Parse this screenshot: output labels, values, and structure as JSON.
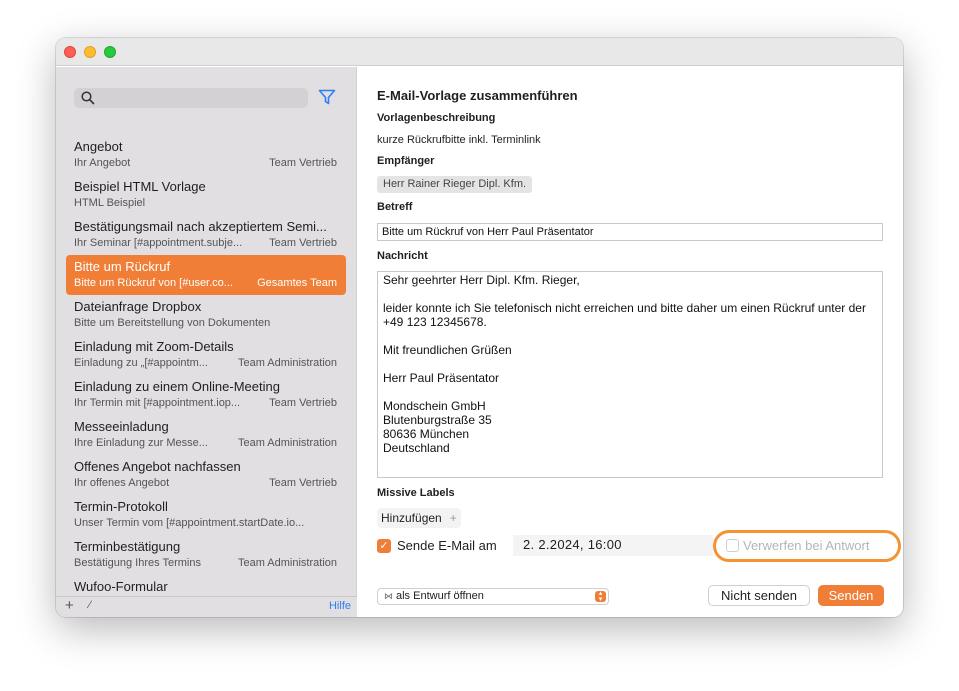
{
  "window": {
    "accent_color": "#f07e37"
  },
  "sidebar": {
    "search": {
      "value": "",
      "placeholder": ""
    },
    "items": [
      {
        "title": "Angebot",
        "subtitle": "Ihr Angebot",
        "group": "Team Vertrieb",
        "selected": false
      },
      {
        "title": "Beispiel HTML Vorlage",
        "subtitle": "HTML Beispiel",
        "group": "",
        "selected": false
      },
      {
        "title": "Bestätigungsmail nach akzeptiertem Semi...",
        "subtitle": "Ihr Seminar [#appointment.subje...",
        "group": "Team Vertrieb",
        "selected": false
      },
      {
        "title": "Bitte um Rückruf",
        "subtitle": "Bitte um Rückruf von [#user.co...",
        "group": "Gesamtes Team",
        "selected": true
      },
      {
        "title": "Dateianfrage Dropbox",
        "subtitle": "Bitte um Bereitstellung von Dokumenten",
        "group": "",
        "selected": false
      },
      {
        "title": "Einladung mit Zoom-Details",
        "subtitle": "Einladung zu „[#appointm...",
        "group": "Team Administration",
        "selected": false
      },
      {
        "title": "Einladung zu einem Online-Meeting",
        "subtitle": "Ihr Termin mit [#appointment.iop...",
        "group": "Team Vertrieb",
        "selected": false
      },
      {
        "title": "Messeeinladung",
        "subtitle": "Ihre Einladung zur Messe...",
        "group": "Team Administration",
        "selected": false
      },
      {
        "title": "Offenes Angebot nachfassen",
        "subtitle": "Ihr offenes Angebot",
        "group": "Team Vertrieb",
        "selected": false
      },
      {
        "title": "Termin-Protokoll",
        "subtitle": "Unser Termin vom [#appointment.startDate.io...",
        "group": "",
        "selected": false
      },
      {
        "title": "Terminbestätigung",
        "subtitle": "Bestätigung Ihres Termins",
        "group": "Team Administration",
        "selected": false
      },
      {
        "title": "Wufoo-Formular",
        "subtitle": "",
        "group": "",
        "selected": false
      }
    ],
    "footer": {
      "add": "+",
      "edit": "⁄",
      "help": "Hilfe"
    }
  },
  "main": {
    "heading": "E-Mail-Vorlage zusammenführen",
    "description_label": "Vorlagenbeschreibung",
    "description": "kurze Rückrufbitte inkl. Terminlink",
    "recipient_label": "Empfänger",
    "recipient": "Herr Rainer Rieger Dipl. Kfm.",
    "subject_label": "Betreff",
    "subject": "Bitte um Rückruf von Herr Paul Präsentator",
    "message_label": "Nachricht",
    "message": "Sehr geehrter Herr Dipl. Kfm. Rieger,\n\nleider konnte ich Sie telefonisch nicht erreichen und bitte daher um einen Rückruf unter der\n+49 123 12345678.\n\nMit freundlichen Grüßen\n\nHerr Paul Präsentator\n\nMondschein GmbH\nBlutenburgstraße 35\n80636 München\nDeutschland",
    "labels_label": "Missive Labels",
    "add_label": "Hinzufügen",
    "add_label_plus": "+",
    "send_checkbox_label": "Sende E-Mail am",
    "send_checked": true,
    "send_date": "2.  2.2024, 16:00",
    "discard_label": "Verwerfen bei Antwort",
    "discard_checked": false,
    "mode_popup": "als Entwurf öffnen",
    "btn_dont_send": "Nicht senden",
    "btn_send": "Senden"
  }
}
